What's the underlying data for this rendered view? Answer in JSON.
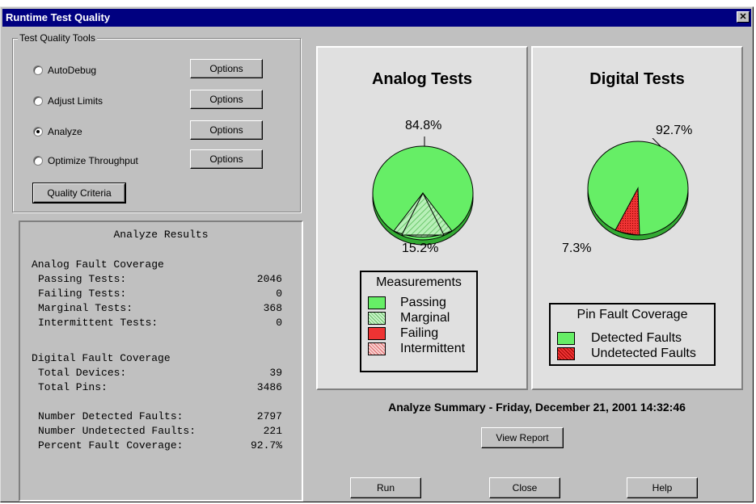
{
  "window": {
    "title": "Runtime Test Quality",
    "close_glyph": "✕"
  },
  "tools": {
    "group_label": "Test Quality Tools",
    "options": [
      {
        "label": "AutoDebug",
        "checked": false,
        "button": "Options"
      },
      {
        "label": "Adjust Limits",
        "checked": false,
        "button": "Options"
      },
      {
        "label": "Analyze",
        "checked": true,
        "button": "Options"
      },
      {
        "label": "Optimize Throughput",
        "checked": false,
        "button": "Options"
      }
    ],
    "quality_criteria_button": "Quality Criteria"
  },
  "results": {
    "title": "Analyze Results",
    "analog_heading": "Analog Fault Coverage",
    "passing_label": "Passing Tests:",
    "passing_value": "2046",
    "failing_label": "Failing Tests:",
    "failing_value": "0",
    "marginal_label": "Marginal Tests:",
    "marginal_value": "368",
    "intermittent_label": "Intermittent Tests:",
    "intermittent_value": "0",
    "digital_heading": "Digital Fault Coverage",
    "devices_label": "Total Devices:",
    "devices_value": "39",
    "pins_label": "Total Pins:",
    "pins_value": "3486",
    "detected_label": "Number Detected Faults:",
    "detected_value": "2797",
    "undetected_label": "Number Undetected Faults:",
    "undetected_value": "221",
    "percent_label": "Percent Fault Coverage:",
    "percent_value": "92.7%"
  },
  "analog_chart": {
    "title": "Analog Tests",
    "passing_pct_label": "84.8%",
    "marginal_pct_label": "15.2%",
    "legend_title": "Measurements",
    "legend": [
      {
        "label": "Passing",
        "color": "#66ee66",
        "pattern": "solid"
      },
      {
        "label": "Marginal",
        "color": "#aaf0aa",
        "pattern": "hatch"
      },
      {
        "label": "Failing",
        "color": "#ee3333",
        "pattern": "solid"
      },
      {
        "label": "Intermittent",
        "color": "#f0a0a0",
        "pattern": "hatch"
      }
    ]
  },
  "digital_chart": {
    "title": "Digital Tests",
    "detected_pct_label": "92.7%",
    "undetected_pct_label": "7.3%",
    "legend_title": "Pin Fault Coverage",
    "legend": [
      {
        "label": "Detected Faults",
        "color": "#66ee66",
        "pattern": "solid"
      },
      {
        "label": "Undetected Faults",
        "color": "#ee3333",
        "pattern": "dots"
      }
    ]
  },
  "summary": {
    "text": "Analyze Summary - Friday, December 21, 2001 14:32:46"
  },
  "buttons": {
    "view_report": "View Report",
    "run": "Run",
    "close": "Close",
    "help": "Help"
  }
}
